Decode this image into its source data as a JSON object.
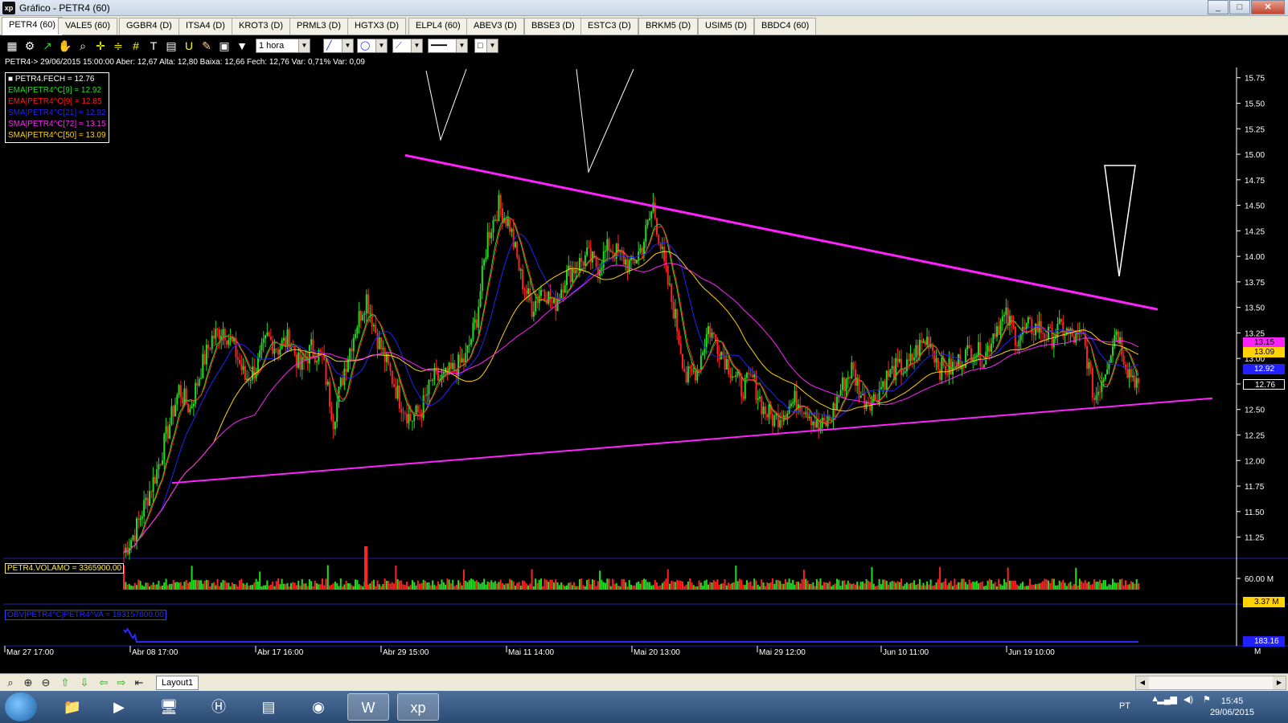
{
  "window": {
    "title": "Gráfico - PETR4 (60)",
    "app_icon": "xp"
  },
  "tabs": [
    "PETR4 (60)",
    "VALE5 (60)",
    "GGBR4 (D)",
    "ITSA4 (D)",
    "KROT3 (D)",
    "PRML3 (D)",
    "HGTX3 (D)",
    "ELPL4 (60)",
    "ABEV3 (D)",
    "BBSE3 (D)",
    "ESTC3 (D)",
    "BRKM5 (D)",
    "USIM5 (D)",
    "BBDC4 (60)"
  ],
  "toolbar": {
    "interval": "1 hora"
  },
  "info_line": "PETR4-> 29/06/2015 15:00:00 Aber: 12,67 Alta: 12,80 Baixa: 12,66 Fech: 12,76 Var: 0,71% Var: 0,09",
  "legend": [
    {
      "text": "PETR4.FECH = 12.76",
      "color": "#ffffff"
    },
    {
      "text": "EMA|PETR4^C[9] = 12.92",
      "color": "#22dd22"
    },
    {
      "text": "EMA|PETR4^O[9] = 12.85",
      "color": "#ff1a1a"
    },
    {
      "text": "SMA|PETR4^C[21] = 12.92",
      "color": "#2222ff"
    },
    {
      "text": "SMA|PETR4^C[72] = 13.15",
      "color": "#ff22ff"
    },
    {
      "text": "SMA|PETR4^C[50] = 13.09",
      "color": "#ffd200"
    }
  ],
  "volume_label": "PETR4.VOLAMO = 3365900.00",
  "obv_label": "OBV|PETR4^C|PETR4^VA = 183157800.00",
  "price_tags": [
    {
      "text": "13.15",
      "color": "#ff22ff",
      "fg": "#000"
    },
    {
      "text": "13.09",
      "color": "#ffd200",
      "fg": "#000"
    },
    {
      "text": "12.92",
      "color": "#2222ff",
      "fg": "#fff"
    },
    {
      "text": "12.76",
      "color": "#000000",
      "fg": "#fff"
    },
    {
      "text": "3.37 M",
      "color": "#ffd200",
      "fg": "#000"
    },
    {
      "text": "183.16 M",
      "color": "#2222ff",
      "fg": "#fff"
    }
  ],
  "layout_tab": "Layout1",
  "taskbar": {
    "lang": "PT",
    "time": "15:45",
    "date": "29/06/2015"
  },
  "chart_data": {
    "type": "line",
    "symbol": "PETR4",
    "y_ticks": [
      "15.75",
      "15.50",
      "15.25",
      "15.00",
      "14.75",
      "14.50",
      "14.25",
      "14.00",
      "13.75",
      "13.50",
      "13.25",
      "13.00",
      "12.75",
      "12.50",
      "12.25",
      "12.00",
      "11.75",
      "11.50",
      "11.25"
    ],
    "ylim": [
      11.05,
      15.85
    ],
    "x_labels": [
      "Mar 27 17:00",
      "Abr 08 17:00",
      "Abr 17 16:00",
      "Abr 29 15:00",
      "Mai 11 14:00",
      "Mai 20 13:00",
      "Mai 29 12:00",
      "Jun 10 11:00",
      "Jun 19 10:00"
    ],
    "volume_ticks": [
      "60.00 M"
    ],
    "obv_ticks": [
      "183.16 M"
    ],
    "close_series": [
      11.1,
      11.3,
      11.6,
      11.9,
      12.3,
      12.7,
      12.5,
      12.9,
      13.2,
      13.3,
      13.1,
      12.8,
      12.9,
      13.2,
      13.1,
      13.2,
      12.9,
      13.1,
      13.0,
      12.4,
      12.9,
      13.3,
      13.6,
      13.2,
      12.9,
      12.6,
      12.4,
      12.5,
      12.8,
      12.8,
      12.9,
      13.0,
      13.4,
      14.2,
      14.5,
      14.3,
      13.8,
      13.5,
      13.7,
      13.5,
      13.8,
      13.9,
      14.0,
      13.9,
      14.1,
      14.0,
      13.9,
      14.1,
      14.5,
      13.9,
      13.4,
      12.8,
      12.9,
      13.3,
      13.1,
      12.9,
      12.7,
      12.8,
      12.5,
      12.4,
      12.5,
      12.6,
      12.5,
      12.3,
      12.4,
      12.7,
      12.9,
      12.6,
      12.6,
      12.8,
      12.9,
      12.9,
      13.1,
      13.2,
      12.9,
      12.9,
      13.0,
      13.1,
      13.0,
      13.3,
      13.4,
      13.2,
      13.3,
      13.3,
      13.2,
      13.3,
      13.2,
      13.2,
      12.6,
      12.9,
      13.3,
      12.9,
      12.76
    ],
    "annotations": {
      "resistance_line": [
        [
          14.99,
          0
        ],
        [
          13.48,
          1
        ]
      ],
      "support_line": [
        [
          11.78,
          0
        ],
        [
          12.61,
          1
        ]
      ]
    }
  }
}
